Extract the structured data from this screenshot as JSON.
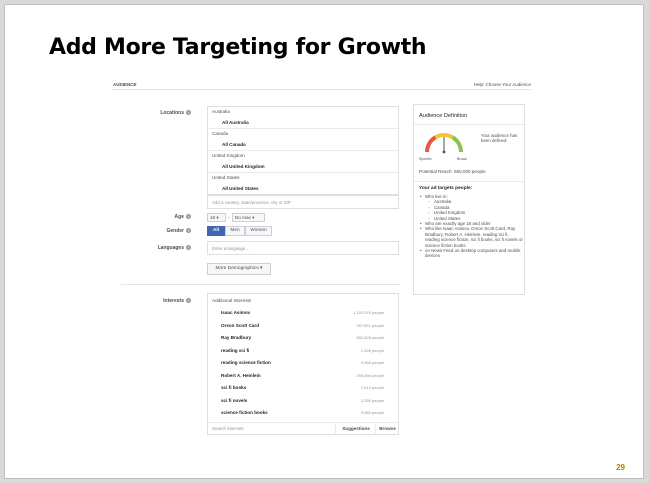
{
  "slide": {
    "title": "Add More Targeting for Growth",
    "page_number": "29"
  },
  "header": {
    "audience_label": "AUDIENCE",
    "help_link": "Help: Choose Your Audience"
  },
  "labels": {
    "locations": "Locations",
    "age": "Age",
    "gender": "Gender",
    "languages": "Languages",
    "interests": "Interests"
  },
  "locations": {
    "items": [
      {
        "region": "Australia",
        "selection": "All Australia"
      },
      {
        "region": "Canada",
        "selection": "All Canada"
      },
      {
        "region": "United Kingdom",
        "selection": "All United Kingdom"
      },
      {
        "region": "United States",
        "selection": "All United States"
      }
    ],
    "placeholder": "Add a country, state/province, city or ZIP"
  },
  "age": {
    "min": "18 ▾",
    "dash": "-",
    "max": "No max ▾"
  },
  "gender": {
    "all": "All",
    "men": "Men",
    "women": "Women"
  },
  "languages": {
    "placeholder": "Enter a language..."
  },
  "more_demographics": "More Demographics ▾",
  "interests": {
    "header": "Additional Interests",
    "items": [
      {
        "name": "Isaac Asimov",
        "count": "1,152,976 people"
      },
      {
        "name": "Orson Scott Card",
        "count": "357,831 people"
      },
      {
        "name": "Ray Bradbury",
        "count": "582,828 people"
      },
      {
        "name": "reading sci fi",
        "count": "2,496 people"
      },
      {
        "name": "reading science fiction",
        "count": "3,968 people"
      },
      {
        "name": "Robert A. Heinlein",
        "count": "298,496 people"
      },
      {
        "name": "sci fi books",
        "count": "1,614 people"
      },
      {
        "name": "sci fi novels",
        "count": "2,256 people"
      },
      {
        "name": "science fiction books",
        "count": "3,585 people"
      }
    ],
    "search_placeholder": "Search interests",
    "suggestions": "Suggestions",
    "browse": "Browse"
  },
  "definition": {
    "title": "Audience Definition",
    "specific": "Specific",
    "broad": "Broad",
    "status": "Your audience has been defined",
    "reach": "Potential Reach: 660,000 people",
    "targets_header": "Your ad targets people:",
    "lives_in": "Who live in:",
    "countries": [
      "Australia",
      "Canada",
      "United Kingdom",
      "United States"
    ],
    "age_line": "Who are exactly age 18 and older",
    "likes_line": "Who like Isaac Asimov, Orson Scott Card, Ray Bradbury, Robert A. Heinlein, reading sci fi, reading science fiction, sci fi books, sci fi novels or science fiction books",
    "placement_line": "on News Feed on desktop computers and mobile devices",
    "gauge_level": 0.5
  },
  "colors": {
    "accent": "#4267b2",
    "gauge_red": "#e9573f",
    "gauge_yellow": "#f5c33b",
    "gauge_green": "#8cc152",
    "page_number": "#c07c00"
  }
}
